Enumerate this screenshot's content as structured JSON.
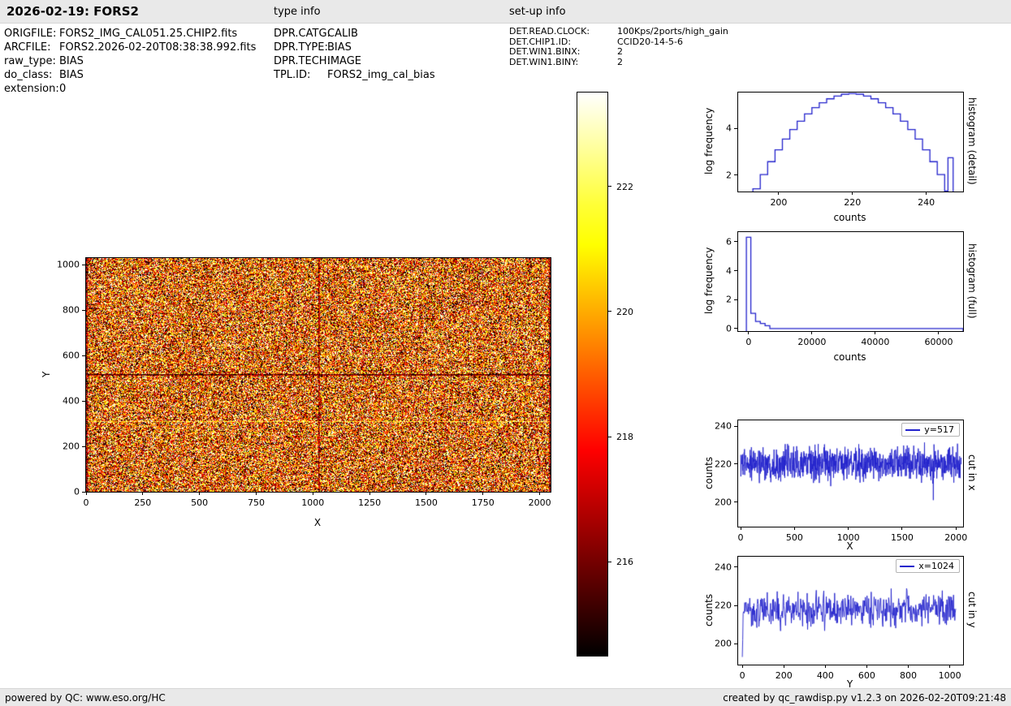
{
  "header": {
    "title": "2026-02-19: FORS2",
    "type_info_label": "type info",
    "setup_info_label": "set-up info"
  },
  "file_info": {
    "rows": [
      {
        "label": "ORIGFILE:",
        "value": "FORS2_IMG_CAL051.25.CHIP2.fits"
      },
      {
        "label": "ARCFILE:",
        "value": "FORS2.2026-02-20T08:38:38.992.fits"
      },
      {
        "label": "raw_type:",
        "value": "BIAS"
      },
      {
        "label": "do_class:",
        "value": "BIAS"
      },
      {
        "label": "extension:",
        "value": "0"
      }
    ]
  },
  "type_info": {
    "rows": [
      {
        "label": "DPR.CATG:",
        "value": "CALIB"
      },
      {
        "label": "DPR.TYPE:",
        "value": "BIAS"
      },
      {
        "label": "DPR.TECH:",
        "value": "IMAGE"
      },
      {
        "label": "TPL.ID:",
        "value": "FORS2_img_cal_bias"
      }
    ]
  },
  "setup_info": {
    "rows": [
      {
        "label": "DET.READ.CLOCK:",
        "value": "100Kps/2ports/high_gain"
      },
      {
        "label": "DET.CHIP1.ID:",
        "value": "CCID20-14-5-6"
      },
      {
        "label": "DET.WIN1.BINX:",
        "value": "2"
      },
      {
        "label": "DET.WIN1.BINY:",
        "value": "2"
      }
    ]
  },
  "footer": {
    "left": "powered by QC: www.eso.org/HC",
    "right": "created by qc_rawdisp.py v1.2.3 on 2026-02-20T09:21:48"
  },
  "colors": {
    "line": "#2222cc",
    "header_bg": "#e9e9e9",
    "colormap": "hot"
  },
  "chart_data": [
    {
      "id": "ccd_image",
      "type": "heatmap",
      "title": "raw CCD bias frame",
      "xlabel": "X",
      "ylabel": "Y",
      "xlim": [
        0,
        2048
      ],
      "ylim": [
        0,
        1030
      ],
      "xticks": [
        0,
        250,
        500,
        750,
        1000,
        1250,
        1500,
        1750,
        2000
      ],
      "yticks": [
        0,
        200,
        400,
        600,
        800,
        1000
      ],
      "colormap": "hot",
      "noise": {
        "mean": 219,
        "sigma": 3.4,
        "seed": 7
      },
      "features": {
        "dark_row_y": 517,
        "dark_col_x": 1024,
        "bright_row_y": 310
      },
      "colorbar": {
        "range": [
          214.5,
          223.5
        ],
        "ticks": [
          216,
          218,
          220,
          222
        ]
      }
    },
    {
      "id": "histogram_detail",
      "type": "step",
      "right_label": "histogram (detail)",
      "xlabel": "counts",
      "ylabel": "log frequency",
      "xlim": [
        189,
        250
      ],
      "ylim": [
        1.3,
        5.55
      ],
      "xticks": [
        200,
        220,
        240
      ],
      "yticks": [
        2,
        4
      ],
      "edges": [
        193,
        195,
        197,
        199,
        201,
        203,
        205,
        207,
        209,
        211,
        213,
        215,
        217,
        219,
        221,
        223,
        225,
        227,
        229,
        231,
        233,
        235,
        237,
        239,
        241,
        243,
        245,
        245.9,
        247.3
      ],
      "values": [
        1.42,
        2.03,
        2.58,
        3.09,
        3.55,
        3.96,
        4.32,
        4.63,
        4.9,
        5.11,
        5.28,
        5.4,
        5.48,
        5.5,
        5.48,
        5.4,
        5.28,
        5.11,
        4.9,
        4.63,
        4.32,
        3.96,
        3.55,
        3.09,
        2.58,
        2.03,
        1.32,
        2.75
      ]
    },
    {
      "id": "histogram_full",
      "type": "step",
      "right_label": "histogram (full)",
      "xlabel": "counts",
      "ylabel": "log frequency",
      "xlim": [
        -3300,
        67700
      ],
      "ylim": [
        -0.17,
        6.66
      ],
      "xticks": [
        0,
        20000,
        40000,
        60000
      ],
      "yticks": [
        0,
        2,
        4,
        6
      ],
      "edges": [
        -700,
        700,
        2200,
        3700,
        5200,
        6700,
        67700
      ],
      "values": [
        6.3,
        1.05,
        0.5,
        0.35,
        0.2,
        0
      ]
    },
    {
      "id": "cut_in_x",
      "type": "noise_line",
      "right_label": "cut in x",
      "xlabel": "X",
      "ylabel": "counts",
      "legend": "y=517",
      "xlim": [
        -23,
        2066
      ],
      "ylim": [
        187,
        243
      ],
      "xticks": [
        0,
        500,
        1000,
        1500,
        2000
      ],
      "yticks": [
        200,
        220,
        240
      ],
      "n": 1024,
      "x_max": 2048,
      "mean": 220,
      "sigma": 4.3,
      "seed": 1234,
      "start_dip": null,
      "spikes": [
        {
          "x": 1790,
          "v": 201
        }
      ]
    },
    {
      "id": "cut_in_y",
      "type": "noise_line",
      "right_label": "cut in y",
      "xlabel": "Y",
      "ylabel": "counts",
      "legend": "x=1024",
      "xlim": [
        -20,
        1064
      ],
      "ylim": [
        189,
        245.5
      ],
      "xticks": [
        0,
        200,
        400,
        600,
        800,
        1000
      ],
      "yticks": [
        200,
        220,
        240
      ],
      "n": 515,
      "x_max": 1030,
      "mean": 218,
      "sigma": 4.3,
      "seed": 4321,
      "start_dip": 193,
      "spikes": []
    }
  ]
}
